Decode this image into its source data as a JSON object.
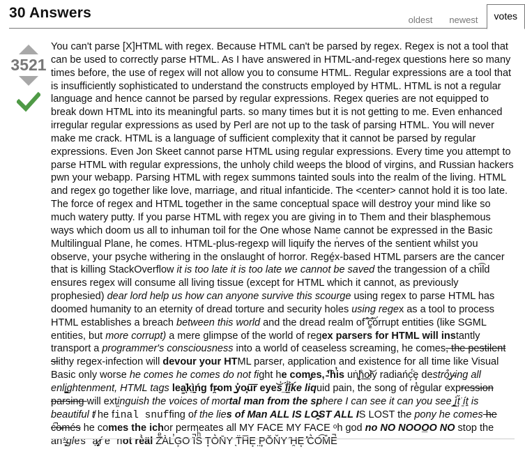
{
  "header": {
    "title": "30 Answers",
    "tabs": [
      {
        "label": "oldest",
        "active": false
      },
      {
        "label": "newest",
        "active": false
      },
      {
        "label": "votes",
        "active": true
      }
    ]
  },
  "vote": {
    "count": "3521",
    "upvote_icon": "up-arrow",
    "downvote_icon": "down-arrow",
    "accepted_icon": "check-mark",
    "arrow_color": "#a8a8a8",
    "accepted_color": "#4f9a46"
  },
  "answer": {
    "s1": "You can't parse [X]HTML with regex. Because HTML can't be parsed by regex. Regex is not a tool that can be used to correctly parse HTML. As I have answered in HTML-and-regex questions here so many times before, the use of regex will not allow you to consume HTML. Regular expressions are a tool that is insufficiently sophisticated to understand the constructs employed by HTML. HTML is not a regular language and hence cannot be parsed by regular expressions. Regex queries are not equipped to break down HTML into its meaningful parts. so many times but it is not getting to me. Even enhanced irregular regular expressions as used by Perl are not up to the task of parsing HTML. You will never make me crack. HTML is a language of sufficient complexity that it cannot be parsed by regular expressions. Even Jon Skeet cannot parse HTML using regular expressions. Every time you attempt to parse HTML with regular expressions, the unholy child weeps the blood of virgins, and Russian hackers pwn your webapp. Parsing HTML with regex summons tainted souls into the realm of the living. HTML and regex go together like love, marriage, and ritual infanticide. The <center> cannot hold it is too late. The force of regex and HTML together in the same conceptual space will destroy your mind like so much watery putty. If you parse HTML with regex you are giving in to Them and their blasphemous ways which doom us all to inhuman toil for the One whose Name cannot be expressed in the Basic Multilingual Plane, he comes. HTML-plus-regexp will liquify the n͗erves of the sentient whilst you observe, your psyche withering in the onslaught of horror. Regé̱x-based HTML parsers are the cancer that is killing StackOverflow ",
    "s2": "it is too late it is too late we cannot be saved",
    "s3": " the trangession of a chi͡ld ensures regex will consume all living tissue (except for HTML which it cannot, as previously prophesied) ",
    "s4": "dear lord help us how can anyone survive this scourge",
    "s5": " using regex to parse HTML has doomed humanity to an eternity of dread torture and security holes ",
    "s6": "using rege",
    "s7": "x as a tool to process HTML establishes a breach ",
    "s8": "between this world",
    "s9": " and the dread realm of ͒͞c̳͒o͛́rrupt entities (like SGML entities, but ",
    "s10": "more corrupt)",
    "s11": " a mere glimp",
    "s12": "se of the world of reg",
    "s13": "ex parsers for HTML will ins",
    "s14": "tantly transport a ",
    "s15": "programmer's consciousness",
    "s16": " into a world of ceaseless screaming, he comes",
    "s17": ", the pestilent sl",
    "s18": "ithy regex-infection will ",
    "s19": "devour your HT",
    "s20": "ML parser, application and existence for all time like Visual Basic only worse ",
    "s21": "he comes he comes do not fi",
    "s22": "ght h",
    "s23": "e com̡es, ̵͡'h̕is",
    "s24": " uṅ̢͖h̐͟o̷͝ly radiańc͕̈́ȩ de",
    "s25": "stro͒͟y̴ing all enli̖͙̪͖̳ghtenment,",
    "s26": " HTML tags ",
    "s27": "lea͚̘͗kì̲̱ńg fr̯͏̶om ̖̗̬y̽o̴͓u͞r eye",
    "s28": "͝s͗ ̲́͘l̾͏̱ĭ̱̉ḱe liq",
    "s29": "uid pain, the song of rè̀gular exp",
    "s30": "ression parsing ",
    "s31": "will ext",
    "s32": "i͖nguish the voices of mor",
    "s33": "tal man from the sp",
    "s34": "here I can see it can you see ",
    "s35": "̲͚̖͔̙ì́t̩́͘ ̱ít͍ is beautiful t",
    "s36": "̸ he f",
    "s37": "inal snuf",
    "s38": "fing o",
    "s39": "f the lie",
    "s40": "s of Man ALL IS LO̶͔̱ST ALL I",
    "s41": "S L",
    "s42": "OST th",
    "s43": "e pon",
    "s44": "y he comes",
    "s45": " he c̍̚o̴més",
    "s46": " he co",
    "s47": "mes the ",
    "s48": "ich",
    "s49": "or permeates al",
    "s50": "l MY FACE MY FACE ᵒh god",
    "s51": " no NO NOOO̲O NO",
    "s52": " stop the an",
    "s53": "*̶͓g",
    "s54": "l",
    "s55": "es ",
    "s56": "ạ̷̡̠r",
    "s57": "́e n",
    "s58": "ot rè̀äl",
    "s59": " Zͤ̓ÀL̕G͕O ̇I̚Sͪ T̟O͛N̄Y ̖T̈H̅E͙ ̤P̥ŎN̆Y͘ ̇H̯E͙ ̽C͛O͡M̎E̚"
  }
}
